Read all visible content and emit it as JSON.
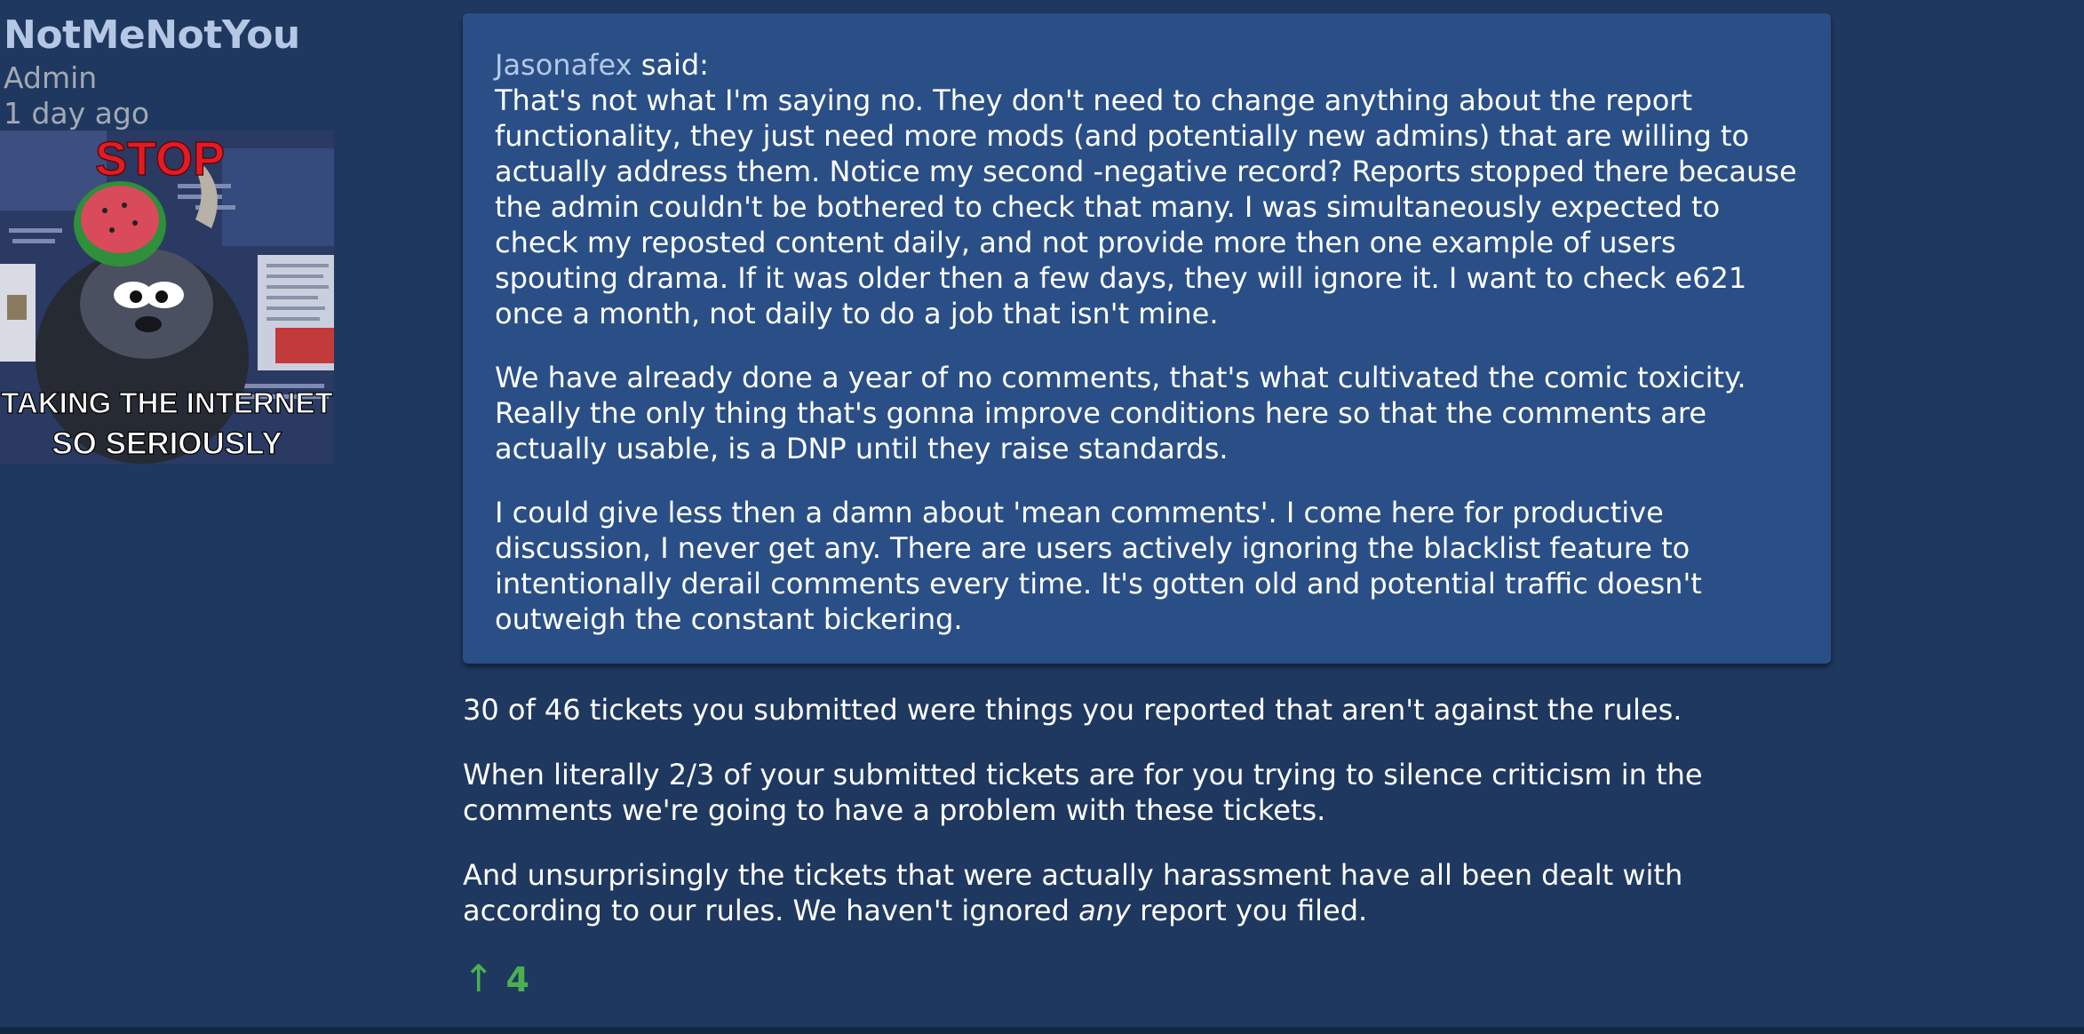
{
  "author": {
    "name": "NotMeNotYou",
    "role": "Admin",
    "time": "1 day ago",
    "avatar": {
      "top_text": "STOP",
      "bottom_text_line1": "TAKING THE INTERNET",
      "bottom_text_line2": "SO SERIOUSLY"
    }
  },
  "quote": {
    "user": "Jasonafex",
    "said": " said:",
    "paragraphs": [
      "That's not what I'm saying no. They don't need to change anything about the report functionality, they just need more mods (and potentially new admins) that are willing to actually address them. Notice my second -negative record? Reports stopped there because the admin couldn't be bothered to check that many. I was simultaneously expected to check my reposted content daily, and not provide more then one example of users spouting drama. If it was older then a few days, they will ignore it. I want to check e621 once a month, not daily to do a job that isn't mine.",
      "We have already done a year of no comments, that's what cultivated the comic toxicity. Really the only thing that's gonna improve conditions here so that the comments are actually usable, is a DNP until they raise standards.",
      "I could give less then a damn about 'mean comments'. I come here for productive discussion, I never get any. There are users actively ignoring the blacklist feature to intentionally derail comments every time. It's gotten old and potential traffic doesn't outweigh the constant bickering."
    ]
  },
  "body": {
    "p1": "30 of 46 tickets you submitted were things you reported that aren't against the rules.",
    "p2": "When literally 2/3 of your submitted tickets are for you trying to silence criticism in the comments we're going to have a problem with these tickets.",
    "p3_before": "And unsurprisingly the tickets that were actually harassment have all been dealt with according to our rules. We haven't ignored ",
    "p3_em": "any",
    "p3_after": " report you filed."
  },
  "score": {
    "arrow": "↑",
    "value": "4"
  }
}
